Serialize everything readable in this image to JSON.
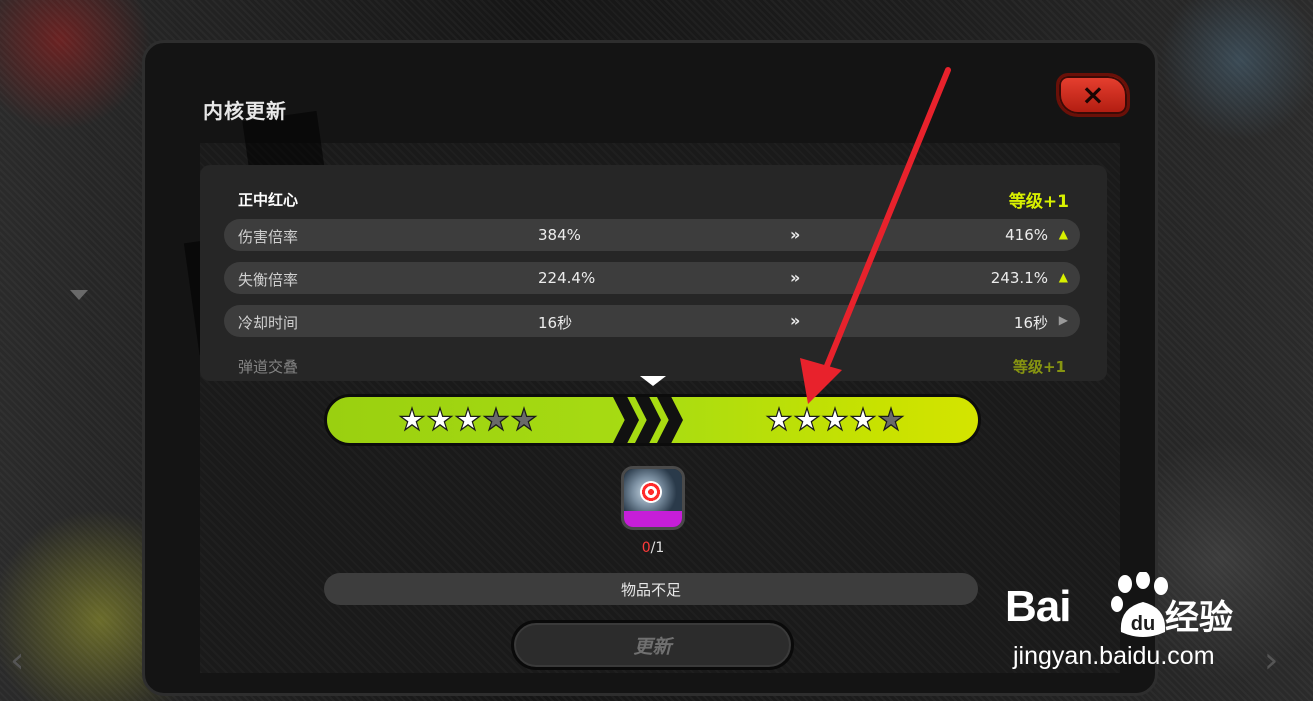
{
  "dialog": {
    "title": "内核更新",
    "close_label": "×"
  },
  "skill": {
    "name": "正中红心",
    "level_change": "等级+1"
  },
  "stats": [
    {
      "label": "伤害倍率",
      "current": "384%",
      "next": "416%",
      "trend": "up"
    },
    {
      "label": "失衡倍率",
      "current": "224.4%",
      "next": "243.1%",
      "trend": "up"
    },
    {
      "label": "冷却时间",
      "current": "16秒",
      "next": "16秒",
      "trend": "same"
    }
  ],
  "stats_partial_row": {
    "label": "弹道交叠",
    "next": "等级+1"
  },
  "arrow_glyph": "»",
  "stars": {
    "current": {
      "filled": 3,
      "total": 5
    },
    "next": {
      "filled": 4,
      "total": 5
    }
  },
  "material": {
    "icon": "core-item-icon",
    "have": "0",
    "need": "/1"
  },
  "notice": "物品不足",
  "update_button": "更新",
  "watermark": {
    "brand_left": "Bai",
    "brand_right": "du",
    "brand_cn": "经验",
    "url": "jingyan.baidu.com"
  },
  "colors": {
    "accent_green": "#a8dc12",
    "level_text": "#d8f000",
    "close_red": "#d8301e",
    "annotation_arrow": "#e8222c",
    "insufficient": "#ff3a3a"
  }
}
